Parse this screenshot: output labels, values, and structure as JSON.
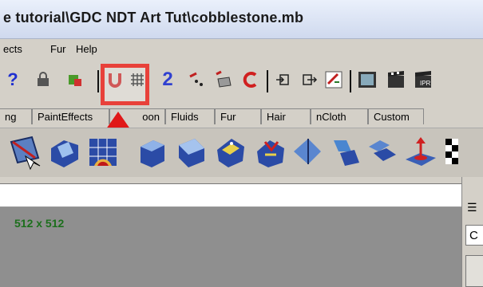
{
  "window": {
    "title": "e tutorial\\GDC NDT Art Tut\\cobblestone.mb"
  },
  "menu": {
    "items": [
      "ects",
      "Fur",
      "Help"
    ]
  },
  "toolbar": {
    "tools": [
      "help-icon",
      "lock-icon",
      "select-icon",
      "magnet-icon",
      "grid-icon",
      "curve-snap-icon",
      "point-snap-icon",
      "plane-snap-icon",
      "rotate-snap-icon",
      "input-icon",
      "output-icon",
      "construction-history-icon",
      "render-view-icon",
      "render-icon",
      "ipr-render-icon"
    ],
    "highlighted": "grid-icon"
  },
  "shelf_tabs": [
    "ng",
    "PaintEffects",
    "oon",
    "Fluids",
    "Fur",
    "Hair",
    "nCloth",
    "Custom"
  ],
  "shelf_icons": [
    "create-uvs-icon",
    "planar-map-icon",
    "uv-editor-icon",
    "cylindrical-map-icon",
    "automatic-map-icon",
    "spherical-map-icon",
    "cut-uv-icon",
    "sew-uv-icon",
    "move-sew-icon",
    "layout-uv-icon",
    "unfold-uv-icon",
    "checker-icon"
  ],
  "viewport": {
    "resolution": "512 x 512"
  },
  "right_panel": {
    "list_icon": "☰",
    "field_text": "C"
  },
  "colors": {
    "highlight": "#e8413a",
    "resolution_text": "#1c6f1c",
    "viewport_bg": "#8f8f8f"
  }
}
